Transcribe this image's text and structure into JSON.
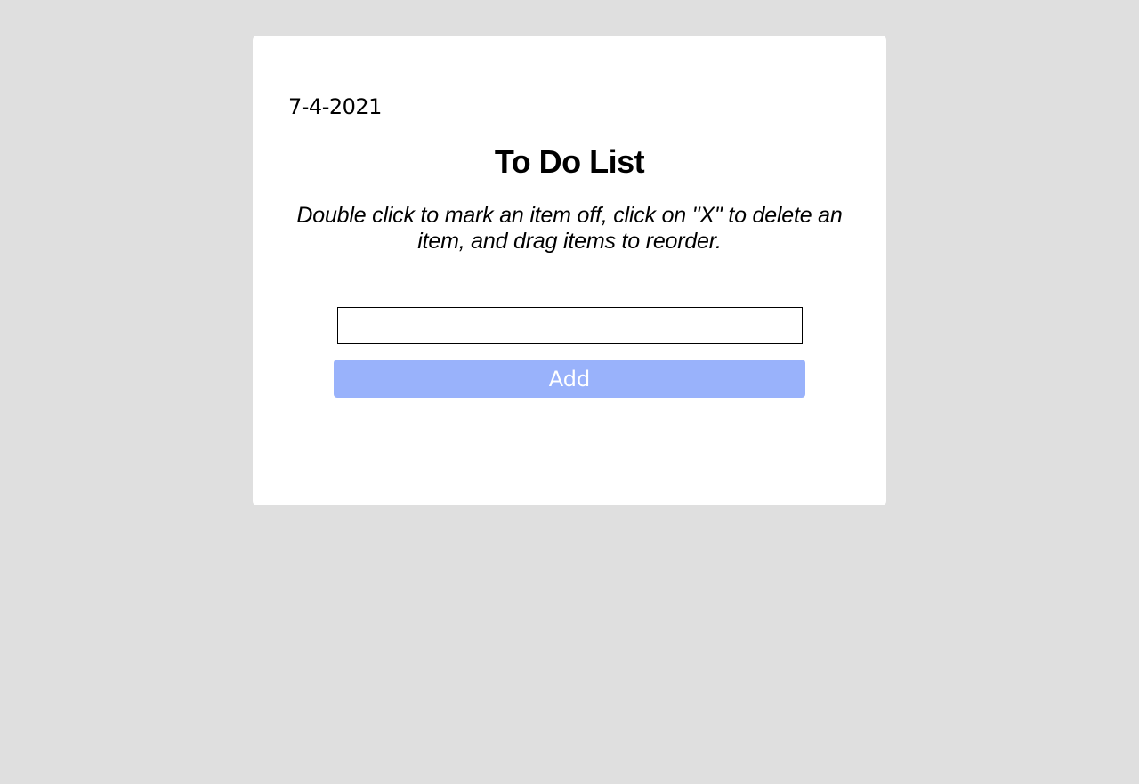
{
  "date": "7-4-2021",
  "title": "To Do List",
  "instructions": "Double click to mark an item off, click on \"X\" to delete an item, and drag items to reorder.",
  "input": {
    "value": "",
    "placeholder": ""
  },
  "add_button": {
    "label": "Add"
  },
  "colors": {
    "background": "#dfdfdf",
    "card": "#ffffff",
    "add_button": "#99b2fb"
  }
}
